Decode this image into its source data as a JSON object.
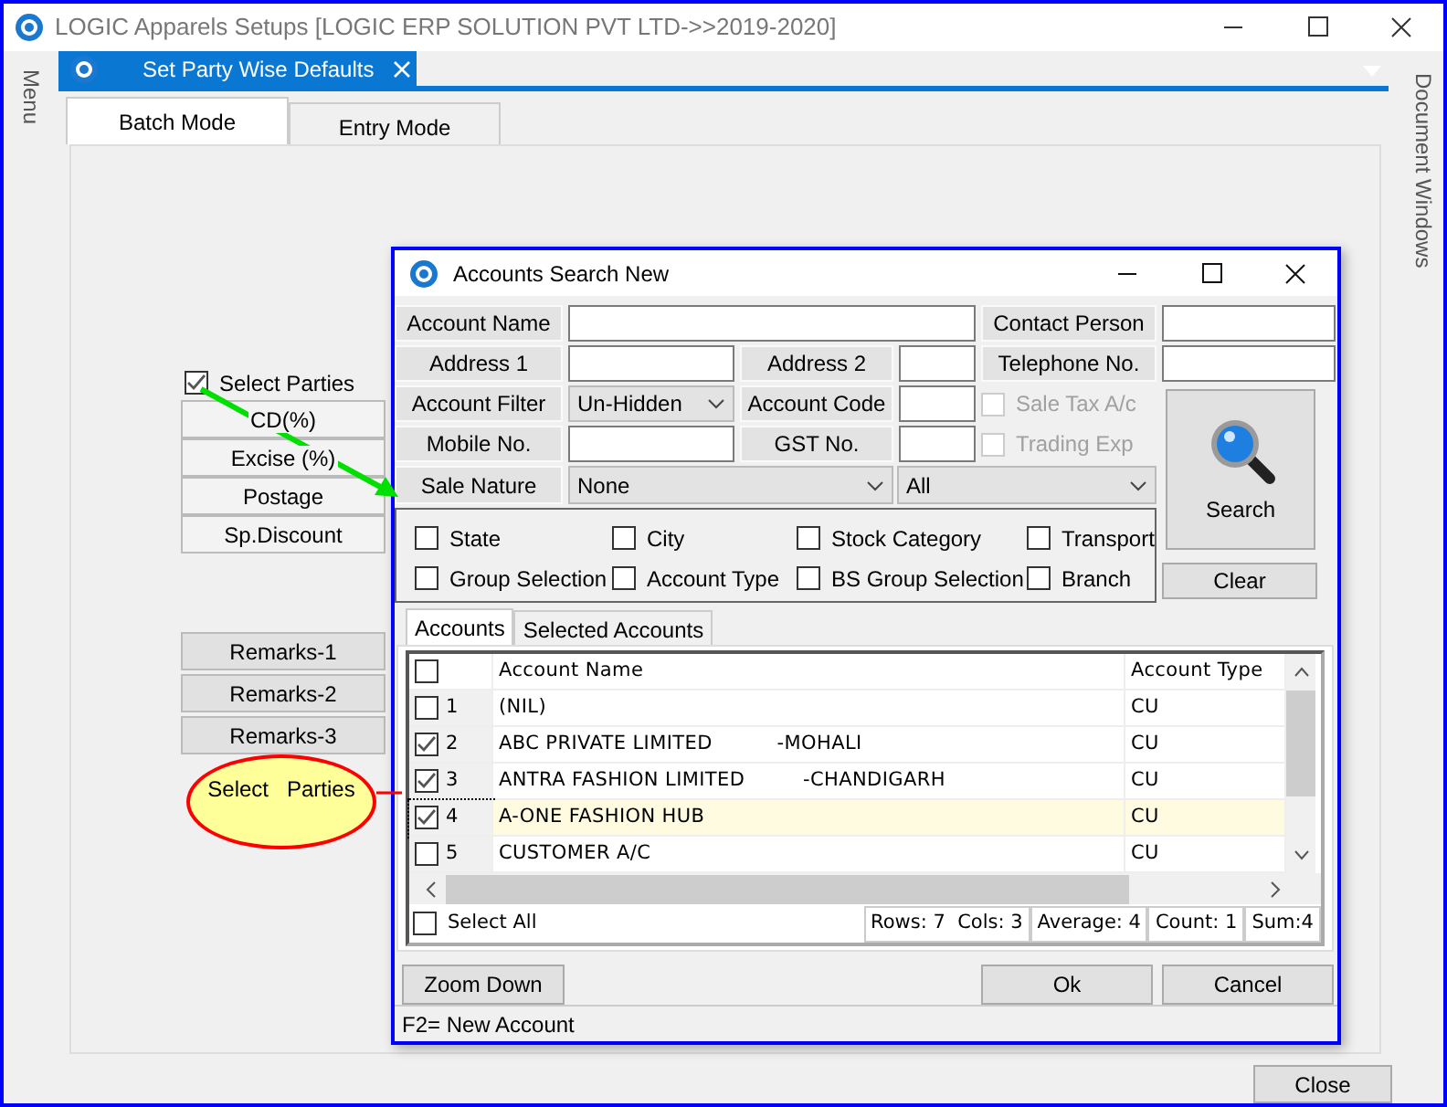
{
  "window": {
    "title": "LOGIC Apparels Setups  [LOGIC ERP SOLUTION PVT LTD->>2019-2020]"
  },
  "side_panels": {
    "left": "Menu",
    "right": "Document Windows"
  },
  "document_tabs": [
    {
      "label": "Set Party Wise Defaults",
      "selected": true
    }
  ],
  "tabs": [
    {
      "label": "Batch Mode",
      "selected": true
    },
    {
      "label": "Entry Mode",
      "selected": false
    }
  ],
  "select_parties": {
    "label": "Select Parties",
    "checked": true
  },
  "charge_buttons": [
    "CD(%)",
    "Excise (%)",
    "Postage",
    "Sp.Discount"
  ],
  "remark_buttons": [
    "Remarks-1",
    "Remarks-2",
    "Remarks-3"
  ],
  "callout": {
    "text": "Select   Parties"
  },
  "close_button": "Close",
  "dialog": {
    "title": "Accounts Search New",
    "filters": [
      {
        "label": "Account Name",
        "kind": "text"
      },
      {
        "label": "Contact Person",
        "kind": "text"
      },
      {
        "label": "Address 1",
        "kind": "text"
      },
      {
        "label": "Address 2",
        "kind": "text"
      },
      {
        "label": "Telephone No.",
        "kind": "text"
      },
      {
        "label": "Account Filter",
        "kind": "select",
        "value": "Un-Hidden"
      },
      {
        "label": "Account Code",
        "kind": "text"
      },
      {
        "label": "Mobile No.",
        "kind": "text"
      },
      {
        "label": "GST No.",
        "kind": "text"
      },
      {
        "label": "Sale Nature",
        "kind": "select",
        "value": "None"
      }
    ],
    "second_select": {
      "value": "All"
    },
    "options": [
      {
        "label": "Sale Tax A/c",
        "checked": false,
        "disabled": true
      },
      {
        "label": "Trading Exp",
        "checked": false,
        "disabled": true
      }
    ],
    "groups": [
      {
        "label": "State",
        "checked": false
      },
      {
        "label": "City",
        "checked": false
      },
      {
        "label": "Stock Category",
        "checked": false
      },
      {
        "label": "Transport",
        "checked": false
      },
      {
        "label": "Group Selection",
        "checked": false
      },
      {
        "label": "Account Type",
        "checked": false
      },
      {
        "label": "BS Group Selection",
        "checked": false
      },
      {
        "label": "Branch",
        "checked": false
      }
    ],
    "search_button": "Search",
    "clear_button": "Clear",
    "tabs": [
      {
        "label": "Accounts",
        "selected": true
      },
      {
        "label": "Selected Accounts",
        "selected": false
      }
    ],
    "grid": {
      "columns": [
        "Account Name",
        "Account Type"
      ],
      "header_checked": false,
      "rows": [
        {
          "number": "1",
          "name": "(NIL)",
          "type": "CU",
          "checked": false,
          "selected": false
        },
        {
          "number": "2",
          "name": "ABC PRIVATE LIMITED          -MOHALI",
          "type": "CU",
          "checked": true,
          "selected": false
        },
        {
          "number": "3",
          "name": "ANTRA FASHION LIMITED         -CHANDIGARH",
          "type": "CU",
          "checked": true,
          "selected": false
        },
        {
          "number": "4",
          "name": "A-ONE FASHION HUB",
          "type": "CU",
          "checked": true,
          "selected": true
        },
        {
          "number": "5",
          "name": "CUSTOMER A/C",
          "type": "CU",
          "checked": false,
          "selected": false
        }
      ]
    },
    "select_all": {
      "label": "Select All",
      "checked": false
    },
    "stats": [
      "Rows: 7  Cols: 3",
      "Average: 4",
      "Count: 1",
      "Sum:4"
    ],
    "buttons": [
      "Zoom Down",
      "Ok",
      "Cancel"
    ],
    "status": "F2= New Account"
  }
}
